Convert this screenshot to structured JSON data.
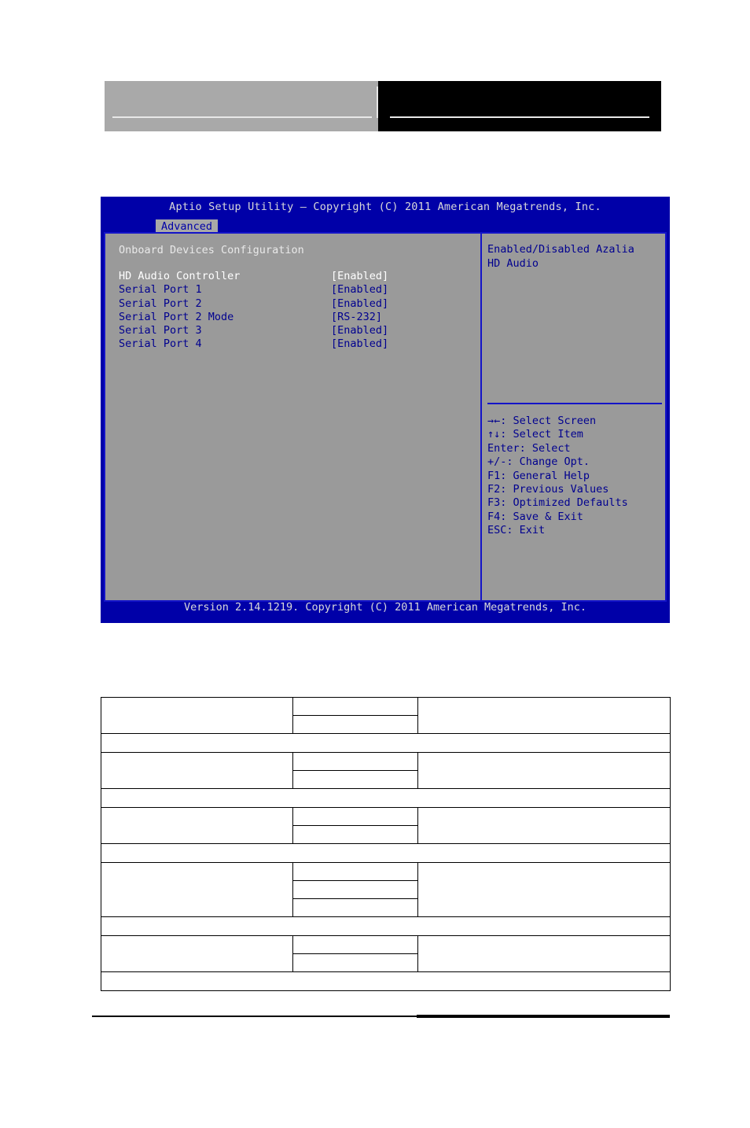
{
  "doc_header": {
    "left_block_label": "",
    "right_block_label": ""
  },
  "bios": {
    "title": "Aptio Setup Utility – Copyright (C) 2011 American Megatrends, Inc.",
    "tabs": [
      {
        "label": "Advanced",
        "active": true
      }
    ],
    "panel_heading": "Onboard Devices Configuration",
    "settings": [
      {
        "label": "HD Audio Controller",
        "value": "[Enabled]",
        "selected": true
      },
      {
        "label": "Serial Port 1",
        "value": "[Enabled]",
        "selected": false
      },
      {
        "label": "Serial Port 2",
        "value": "[Enabled]",
        "selected": false
      },
      {
        "label": "Serial Port 2 Mode",
        "value": "[RS-232]",
        "selected": false
      },
      {
        "label": "Serial Port 3",
        "value": "[Enabled]",
        "selected": false
      },
      {
        "label": "Serial Port 4",
        "value": "[Enabled]",
        "selected": false
      }
    ],
    "help_text": "Enabled/Disabled Azalia HD Audio",
    "nav_keys": [
      "→←: Select Screen",
      "↑↓: Select Item",
      "Enter: Select",
      "+/-: Change Opt.",
      "F1: General Help",
      "F2: Previous Values",
      "F3: Optimized Defaults",
      "F4: Save & Exit",
      "ESC: Exit"
    ],
    "version_bar": "Version 2.14.1219. Copyright (C) 2011 American Megatrends, Inc.",
    "colors": {
      "screen_blue": "#0000a8",
      "panel_gray": "#9a9a9a",
      "border_blue": "#1414c8",
      "text_blue": "#00008f",
      "text_white": "#e9e9e9"
    }
  },
  "spec_table": {
    "rows": [
      {
        "type": "group",
        "cell_a": "",
        "cell_b": [
          "",
          ""
        ],
        "cell_c": ""
      },
      {
        "type": "spacer",
        "text": ""
      },
      {
        "type": "group",
        "cell_a": "",
        "cell_b": [
          "",
          ""
        ],
        "cell_c": ""
      },
      {
        "type": "spacer",
        "text": ""
      },
      {
        "type": "group",
        "cell_a": "",
        "cell_b": [
          "",
          ""
        ],
        "cell_c": ""
      },
      {
        "type": "spacer",
        "text": ""
      },
      {
        "type": "group",
        "cell_a": "",
        "cell_b": [
          "",
          "",
          ""
        ],
        "cell_c": ""
      },
      {
        "type": "spacer",
        "text": ""
      },
      {
        "type": "group",
        "cell_a": "",
        "cell_b": [
          "",
          ""
        ],
        "cell_c": ""
      },
      {
        "type": "spacer",
        "text": ""
      }
    ]
  }
}
